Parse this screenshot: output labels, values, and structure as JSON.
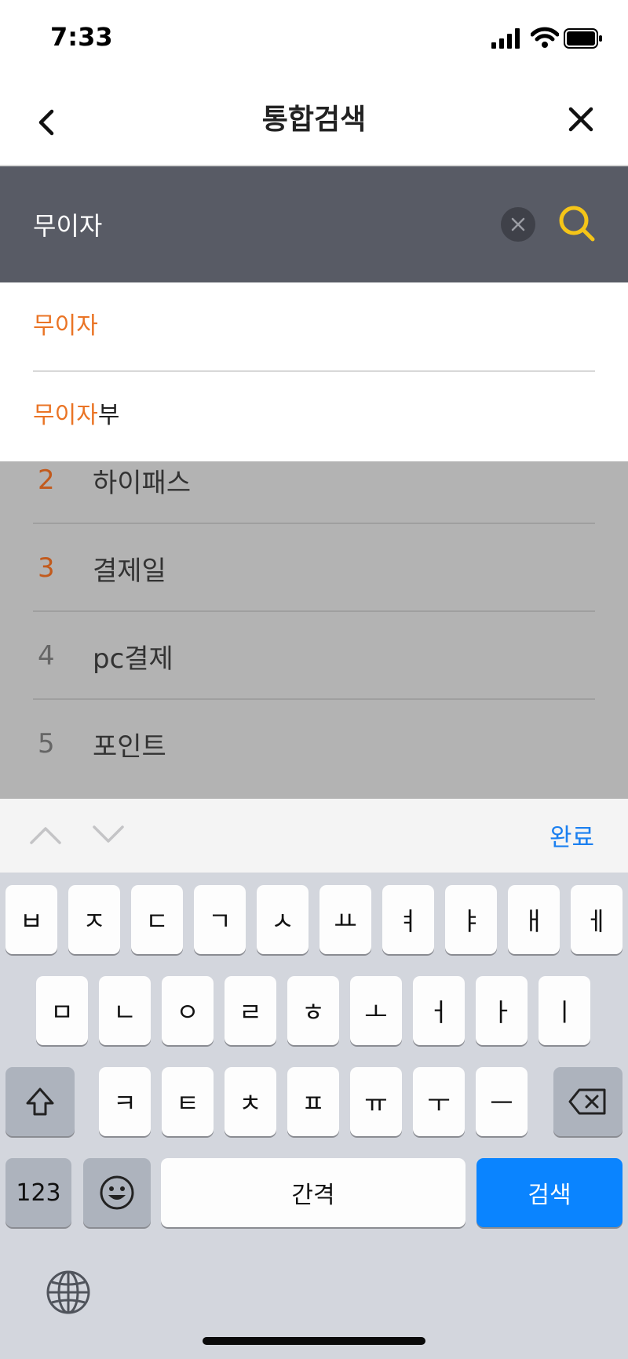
{
  "status_bar": {
    "time": "7:33",
    "icons": [
      "signal-icon",
      "wifi-icon",
      "battery-icon"
    ]
  },
  "nav": {
    "title": "통합검색",
    "back_icon": "chevron-left-icon",
    "close_icon": "close-icon"
  },
  "search": {
    "value": "무이자",
    "placeholder": "",
    "clear_icon": "clear-icon",
    "search_icon": "search-icon"
  },
  "suggestions": [
    {
      "match": "무이자",
      "rest": ""
    },
    {
      "match": "무이자",
      "rest": "부"
    }
  ],
  "ranking": [
    {
      "rank": "2",
      "term": "하이패스",
      "rank_color": "#c25a1c"
    },
    {
      "rank": "3",
      "term": "결제일",
      "rank_color": "#c25a1c"
    },
    {
      "rank": "4",
      "term": "pc결제",
      "rank_color": "#666666"
    },
    {
      "rank": "5",
      "term": "포인트",
      "rank_color": "#666666"
    }
  ],
  "accessory": {
    "done_label": "완료",
    "up_icon": "chevron-up-icon",
    "down_icon": "chevron-down-icon"
  },
  "keyboard": {
    "row1": [
      "ㅂ",
      "ㅈ",
      "ㄷ",
      "ㄱ",
      "ㅅ",
      "ㅛ",
      "ㅕ",
      "ㅑ",
      "ㅐ",
      "ㅔ"
    ],
    "row2": [
      "ㅁ",
      "ㄴ",
      "ㅇ",
      "ㄹ",
      "ㅎ",
      "ㅗ",
      "ㅓ",
      "ㅏ",
      "ㅣ"
    ],
    "row3": [
      "ㅋ",
      "ㅌ",
      "ㅊ",
      "ㅍ",
      "ㅠ",
      "ㅜ",
      "ㅡ"
    ],
    "numbers_label": "123",
    "space_label": "간격",
    "search_label": "검색",
    "shift_icon": "shift-icon",
    "delete_icon": "delete-icon",
    "emoji_icon": "emoji-icon",
    "globe_icon": "globe-icon"
  },
  "colors": {
    "accent": "#ea7425",
    "search_bar": "#585b65",
    "search_icon": "#f5c518",
    "key_blue": "#0a84ff"
  }
}
